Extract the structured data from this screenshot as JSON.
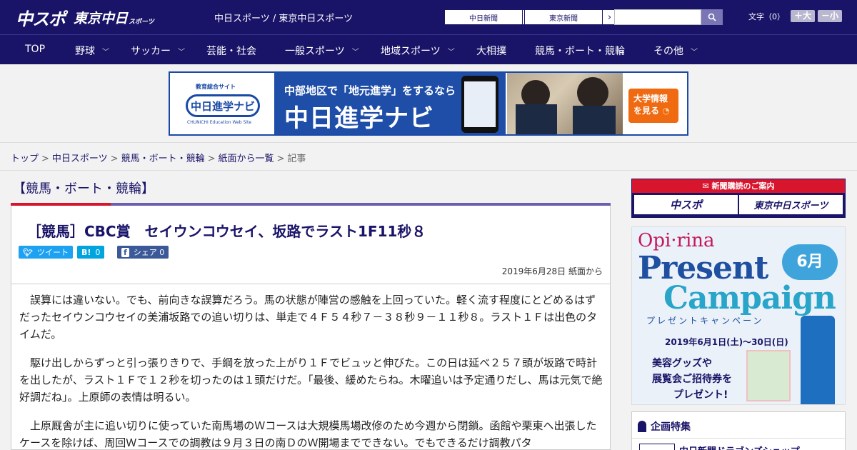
{
  "header": {
    "logo_main": "中スポ",
    "logo_tokyo": "東京中日",
    "logo_sports": "スポーツ",
    "site_name": "中日スポーツ / 東京中日スポーツ",
    "paper_links": [
      {
        "label": "中日新聞"
      },
      {
        "label": "東京新聞"
      }
    ],
    "search": {
      "placeholder": ""
    },
    "font_size": {
      "label": "文字（0）",
      "plus": "＋大",
      "minus": "－小"
    }
  },
  "nav": {
    "items": [
      {
        "label": "TOP",
        "dropdown": false
      },
      {
        "label": "野球",
        "dropdown": true
      },
      {
        "label": "サッカー",
        "dropdown": true
      },
      {
        "label": "芸能・社会",
        "dropdown": false
      },
      {
        "label": "一般スポーツ",
        "dropdown": true
      },
      {
        "label": "地域スポーツ",
        "dropdown": true
      },
      {
        "label": "大相撲",
        "dropdown": false
      },
      {
        "label": "競馬・ボート・競輪",
        "dropdown": false
      },
      {
        "label": "その他",
        "dropdown": true
      }
    ]
  },
  "banner": {
    "small_label": "教育総合サイト",
    "logo_text": "中日進学ナビ",
    "logo_en": "CHUNICHI Education Web Site",
    "line1": "中部地区で「地元進学」をするなら",
    "line2": "中日進学ナビ",
    "cta_line1": "大学情報",
    "cta_line2": "を見る"
  },
  "breadcrumb": [
    {
      "label": "トップ",
      "link": true
    },
    {
      "label": "中日スポーツ",
      "link": true
    },
    {
      "label": "競馬・ボート・競輪",
      "link": true
    },
    {
      "label": "紙面から一覧",
      "link": true
    },
    {
      "label": "記事",
      "link": false
    }
  ],
  "article": {
    "category": "【競馬・ボート・競輪】",
    "title": "［競馬］CBC賞　セイウンコウセイ、坂路でラスト1F11秒８",
    "share": {
      "twitter": {
        "label": "ツイート",
        "icon": "twitter-bird-icon"
      },
      "hatena": {
        "label": "0",
        "icon": "B!"
      },
      "facebook": {
        "label": "シェア 0",
        "icon": "f"
      }
    },
    "meta": "2019年6月28日 紙面から",
    "paragraphs": [
      "誤算には違いない。でも、前向きな誤算だろう。馬の状態が陣営の感触を上回っていた。軽く流す程度にとどめるはずだったセイウンコウセイの美浦坂路での追い切りは、単走で４Ｆ５４秒７－３８秒９－１１秒８。ラスト１Ｆは出色のタイムだ。",
      "駆け出しからずっと引っ張りきりで、手綱を放った上がり１Ｆでビュッと伸びた。この日は延べ２５７頭が坂路で時計を出したが、ラスト１Ｆで１２秒を切ったのは１頭だけだ。「最後、緩めたらね。木曜追いは予定通りだし、馬は元気で絶好調だね」。上原師の表情は明るい。",
      "上原厩舎が主に追い切りに使っていた南馬場のＷコースは大規模馬場改修のため今週から閉鎖。函館や栗東へ出張したケースを除けば、周回Ｗコースでの調教は９月３日の南ＤのＷ開場までできない。でもできるだけ調教パタ"
    ]
  },
  "sidebar": {
    "subscribe": {
      "header": "新聞購読のご案内",
      "buttons": [
        "中スポ",
        "東京中日スポーツ"
      ]
    },
    "ad": {
      "brand": "Opi·rina",
      "month": "6月",
      "line1": "Present",
      "line2": "Campaign",
      "kana": "プレゼントキャンペーン",
      "date": "2019年6月1日(土)～30日(日)",
      "msg1": "美容グッズや",
      "msg2": "展覧会ご招待券を",
      "msg3": "プレゼント!"
    },
    "feature": {
      "title": "企画特集",
      "item": "中日新聞ドラゴンズショップ"
    }
  },
  "colors": {
    "brand_navy": "#1a1468",
    "accent_red": "#d7162e",
    "twitter_blue": "#1da1f2",
    "hatena_blue": "#00a4de",
    "facebook_blue": "#3b5998"
  }
}
